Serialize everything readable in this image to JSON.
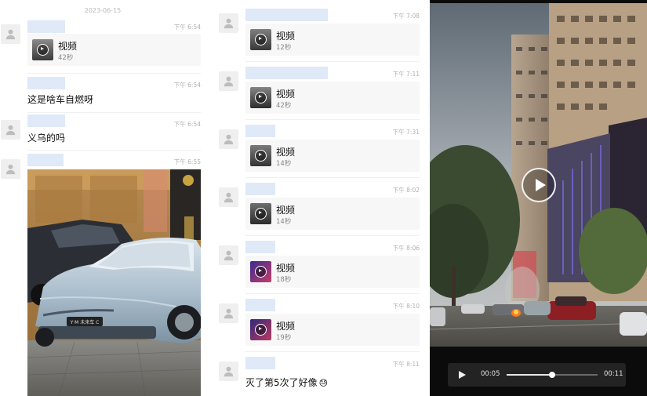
{
  "panel1": {
    "date": "2023-06-15",
    "messages": [
      {
        "time": "下午 6:54",
        "video_label": "视频",
        "video_duration": "42秒"
      },
      {
        "time": "下午 6:54",
        "text": "这是啥车自燃呀"
      },
      {
        "time": "下午 6:54",
        "text": "义乌的吗"
      },
      {
        "time": "下午 6:55"
      }
    ],
    "photo": {
      "plate_text": "Y·M 未来车 C"
    }
  },
  "panel2": {
    "messages": [
      {
        "time": "下午 7:08",
        "video_label": "视频",
        "video_duration": "12秒"
      },
      {
        "time": "下午 7:11",
        "video_label": "视频",
        "video_duration": "42秒"
      },
      {
        "time": "下午 7:31",
        "video_label": "视频",
        "video_duration": "14秒"
      },
      {
        "time": "下午 8:02",
        "video_label": "视频",
        "video_duration": "14秒"
      },
      {
        "time": "下午 8:06",
        "video_label": "视频",
        "video_duration": "18秒"
      },
      {
        "time": "下午 8:10",
        "video_label": "视频",
        "video_duration": "19秒"
      },
      {
        "time": "下午 8:11",
        "text": "灭了第5次了好像",
        "emoji": "😓"
      }
    ]
  },
  "player": {
    "current_time": "00:05",
    "total_time": "00:11",
    "progress": 0.5
  },
  "colors": {
    "name_bar": "#dfe9f7",
    "bubble": "#f7f7f7",
    "time_text": "#b0b0b0"
  }
}
